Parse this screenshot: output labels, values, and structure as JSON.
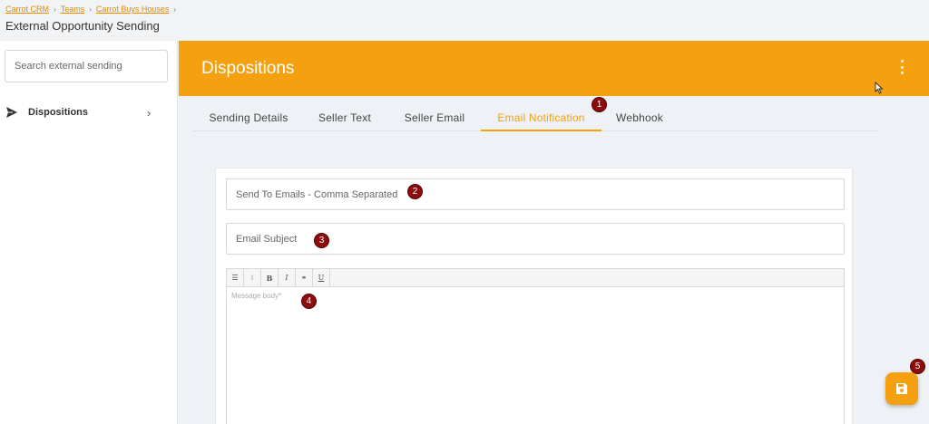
{
  "breadcrumb": {
    "items": [
      "Carrot CRM",
      "Teams",
      "Carrot Buys Houses"
    ],
    "separator": "›"
  },
  "page_title": "External Opportunity Sending",
  "sidebar": {
    "search_placeholder": "Search external sending",
    "items": [
      {
        "label": "Dispositions",
        "icon": "send-icon",
        "chevron": "›"
      }
    ]
  },
  "header": {
    "title": "Dispositions",
    "menu_icon": "more-vertical-icon"
  },
  "tabs": [
    {
      "label": "Sending Details",
      "active": false
    },
    {
      "label": "Seller Text",
      "active": false
    },
    {
      "label": "Seller Email",
      "active": false
    },
    {
      "label": "Email Notification",
      "active": true
    },
    {
      "label": "Webhook",
      "active": false
    }
  ],
  "form": {
    "send_to_placeholder": "Send To Emails - Comma Separated",
    "subject_placeholder": "Email Subject",
    "toolbar": [
      {
        "icon": "bulleted-list-icon",
        "glyph": "☰"
      },
      {
        "icon": "numbered-list-icon",
        "glyph": "⁝"
      },
      {
        "icon": "bold-icon",
        "glyph": "B"
      },
      {
        "icon": "italic-icon",
        "glyph": "I"
      },
      {
        "icon": "link-icon",
        "glyph": "⚭"
      },
      {
        "icon": "underline-icon",
        "glyph": "U"
      }
    ],
    "body_placeholder": "Message body*"
  },
  "badges": [
    "1",
    "2",
    "3",
    "4",
    "5"
  ],
  "save_icon": "save-icon",
  "colors": {
    "accent": "#f5a00f",
    "badge": "#8b0d0d",
    "link": "#e08a00"
  }
}
